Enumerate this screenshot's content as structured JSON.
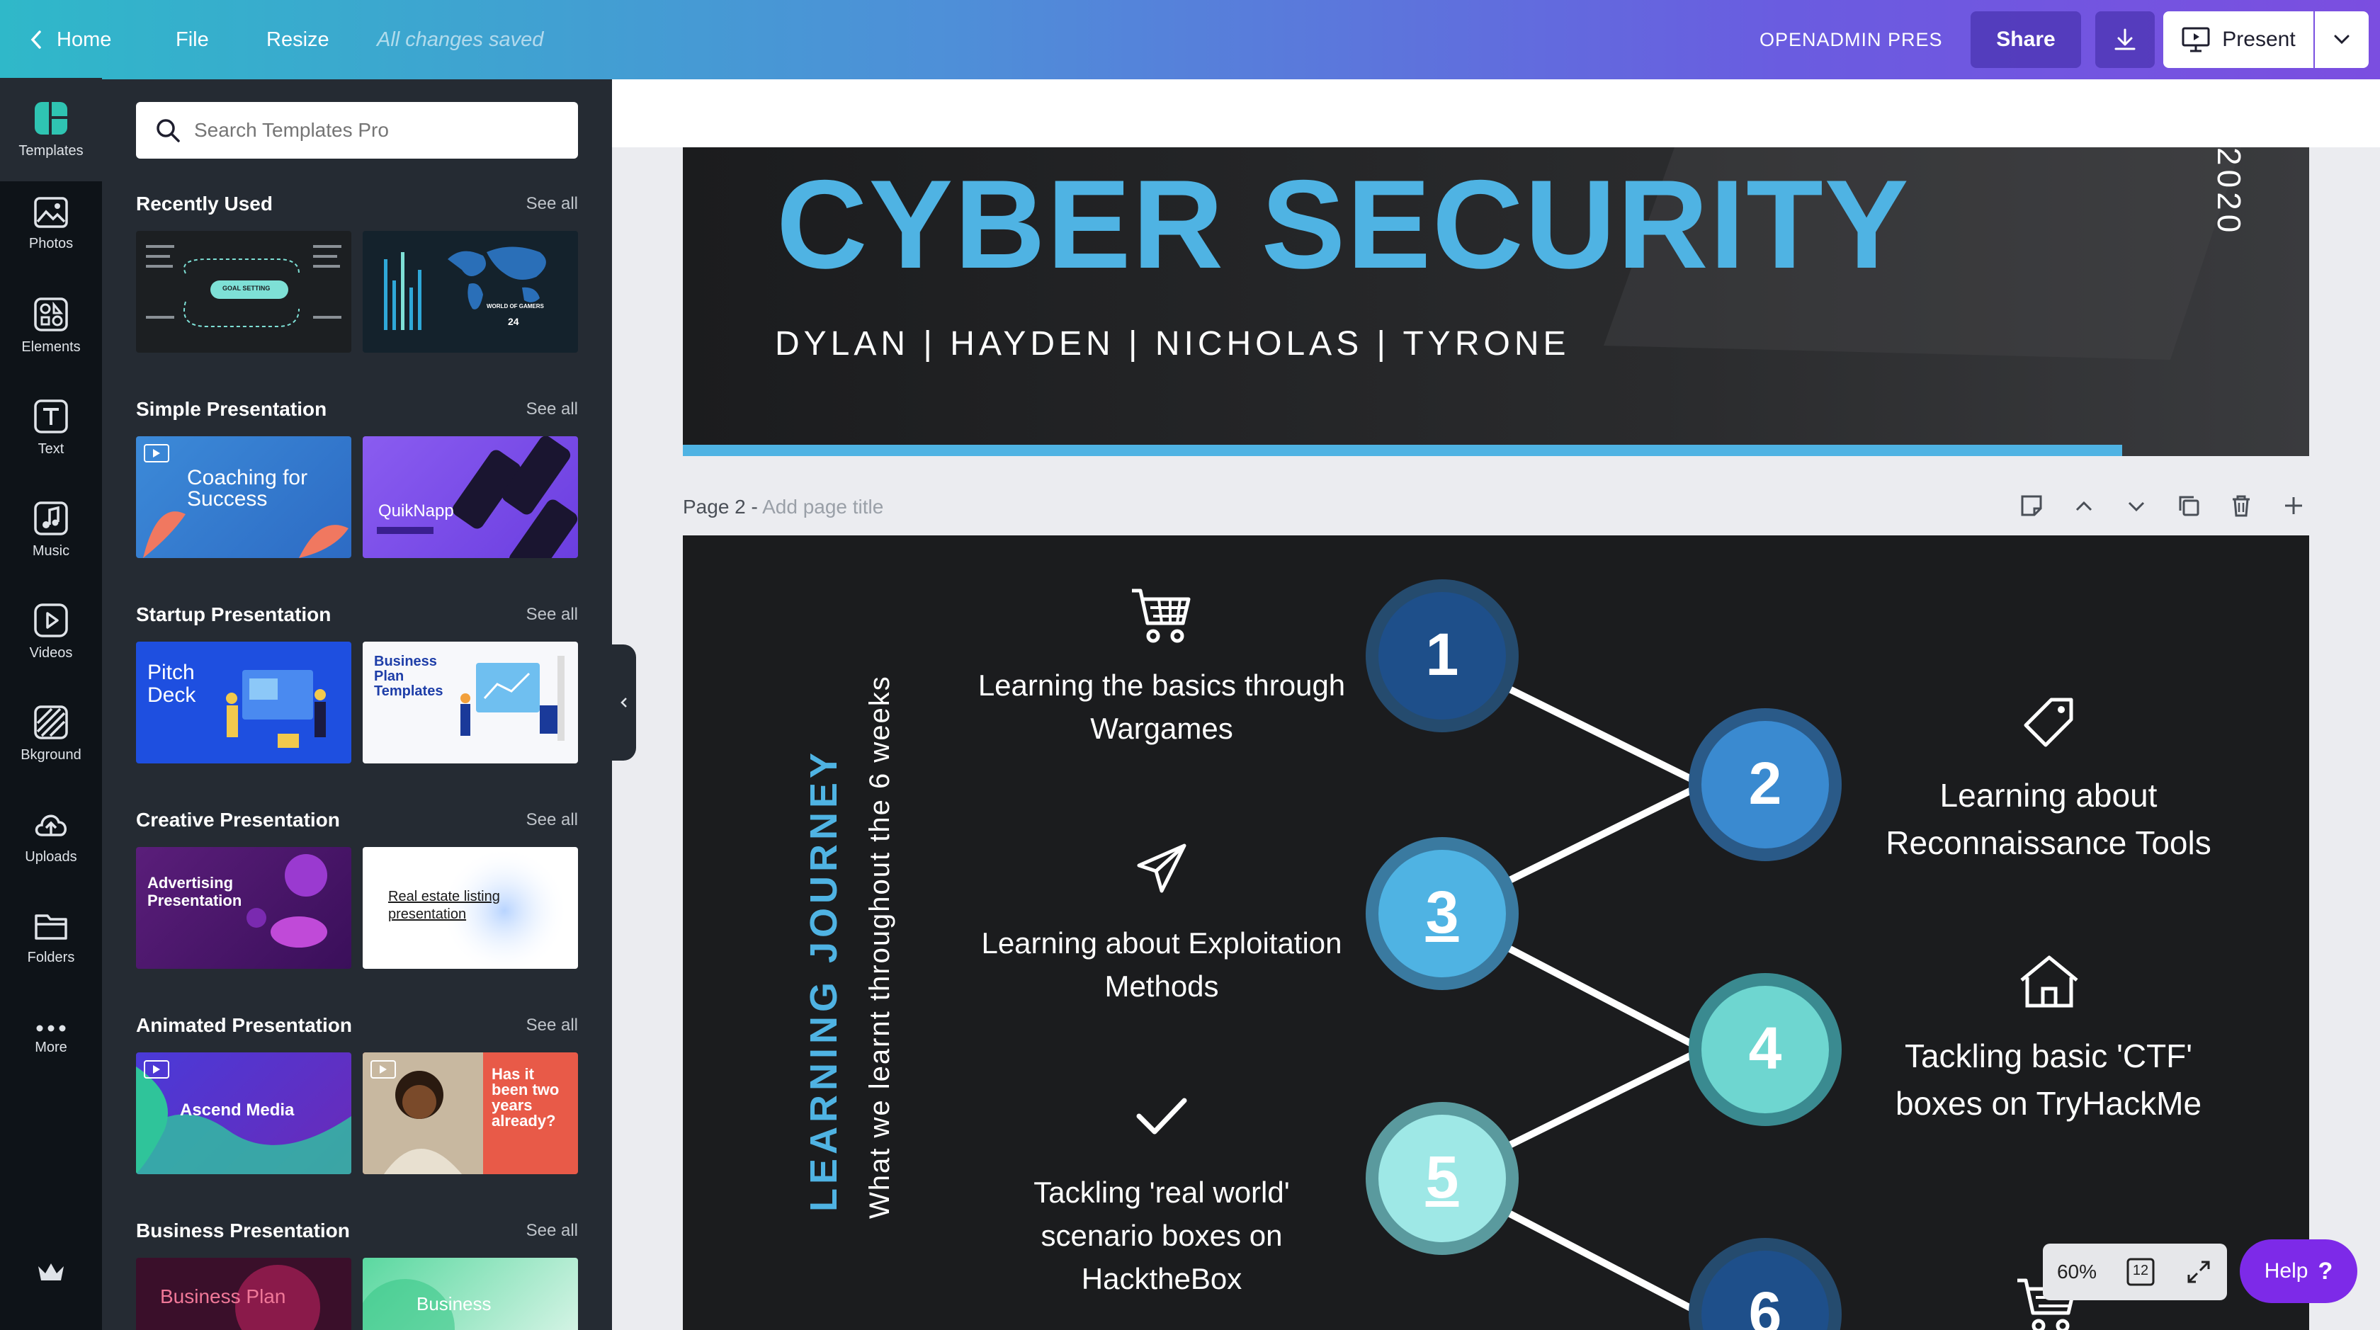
{
  "topbar": {
    "home": "Home",
    "file": "File",
    "resize": "Resize",
    "saved": "All changes saved",
    "doc_title": "OPENADMIN PRES",
    "share": "Share",
    "present": "Present"
  },
  "rail": {
    "items": [
      {
        "label": "Templates",
        "icon": "templates-icon"
      },
      {
        "label": "Photos",
        "icon": "photos-icon"
      },
      {
        "label": "Elements",
        "icon": "elements-icon"
      },
      {
        "label": "Text",
        "icon": "text-icon"
      },
      {
        "label": "Music",
        "icon": "music-icon"
      },
      {
        "label": "Videos",
        "icon": "videos-icon"
      },
      {
        "label": "Bkground",
        "icon": "background-icon"
      },
      {
        "label": "Uploads",
        "icon": "uploads-icon"
      },
      {
        "label": "Folders",
        "icon": "folders-icon"
      },
      {
        "label": "More",
        "icon": "more-icon"
      }
    ]
  },
  "panel": {
    "search_placeholder": "Search Templates Pro",
    "see_all": "See all",
    "sections": [
      {
        "title": "Recently Used",
        "thumbs": [
          {
            "text": "GOAL SETTING"
          },
          {
            "text": "WORLD OF GAMERS",
            "num": "24"
          }
        ]
      },
      {
        "title": "Simple Presentation",
        "thumbs": [
          {
            "text": "Coaching for Success"
          },
          {
            "text": "QuikNapp"
          }
        ]
      },
      {
        "title": "Startup Presentation",
        "thumbs": [
          {
            "text": "Pitch Deck"
          },
          {
            "text": "Business Plan Templates"
          }
        ]
      },
      {
        "title": "Creative Presentation",
        "thumbs": [
          {
            "text": "Advertising Presentation"
          },
          {
            "text": "Real estate listing presentation"
          }
        ]
      },
      {
        "title": "Animated Presentation",
        "thumbs": [
          {
            "text": "Ascend Media"
          },
          {
            "text": "Has it been two years already?"
          }
        ]
      },
      {
        "title": "Business Presentation",
        "thumbs": [
          {
            "text": "Business Plan"
          },
          {
            "text": "Business"
          }
        ]
      }
    ]
  },
  "page1": {
    "title": "CYBER SECURITY",
    "names": "DYLAN | HAYDEN | NICHOLAS | TYRONE",
    "year": "2020"
  },
  "page2": {
    "label": "Page 2 -",
    "title_placeholder": "Add page title",
    "vertical_title": "LEARNING JOURNEY",
    "vertical_subtitle": "What we learnt throughout the 6 weeks",
    "left_items": [
      {
        "text": "Learning the basics through Wargames",
        "icon": "cart-icon"
      },
      {
        "text": "Learning about Exploitation Methods",
        "icon": "paper-plane-icon"
      },
      {
        "text": "Tackling 'real world' scenario boxes on HacktheBox",
        "icon": "checkmark-icon"
      }
    ],
    "right_items": [
      {
        "text": "Learning about Reconnaissance Tools",
        "icon": "tag-icon"
      },
      {
        "text": "Tackling basic 'CTF' boxes on TryHackMe",
        "icon": "house-icon"
      }
    ],
    "steps": [
      "1",
      "2",
      "3",
      "4",
      "5",
      "6"
    ]
  },
  "bottom": {
    "zoom": "60%",
    "page_count": "12",
    "help": "Help"
  }
}
